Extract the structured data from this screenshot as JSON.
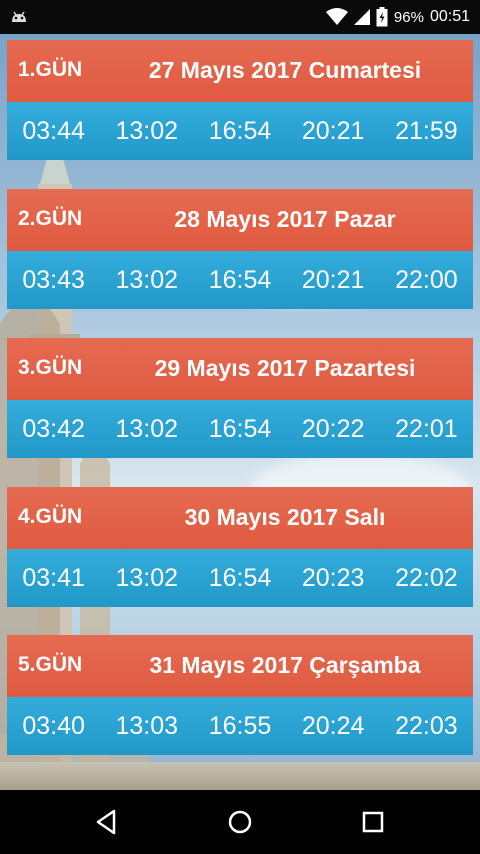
{
  "status_bar": {
    "battery_percent": "96%",
    "time": "00:51"
  },
  "days": [
    {
      "label": "1.GÜN",
      "date": "27 Mayıs 2017 Cumartesi",
      "times": [
        "03:44",
        "13:02",
        "16:54",
        "20:21",
        "21:59"
      ]
    },
    {
      "label": "2.GÜN",
      "date": "28 Mayıs 2017 Pazar",
      "times": [
        "03:43",
        "13:02",
        "16:54",
        "20:21",
        "22:00"
      ]
    },
    {
      "label": "3.GÜN",
      "date": "29 Mayıs 2017 Pazartesi",
      "times": [
        "03:42",
        "13:02",
        "16:54",
        "20:22",
        "22:01"
      ]
    },
    {
      "label": "4.GÜN",
      "date": "30 Mayıs 2017 Salı",
      "times": [
        "03:41",
        "13:02",
        "16:54",
        "20:23",
        "22:02"
      ]
    },
    {
      "label": "5.GÜN",
      "date": "31 Mayıs 2017 Çarşamba",
      "times": [
        "03:40",
        "13:03",
        "16:55",
        "20:24",
        "22:03"
      ]
    }
  ],
  "colors": {
    "header": "#e8624a",
    "times_row": "#2aa3d3"
  },
  "nav_icons": [
    "back-icon",
    "home-icon",
    "recents-icon"
  ]
}
